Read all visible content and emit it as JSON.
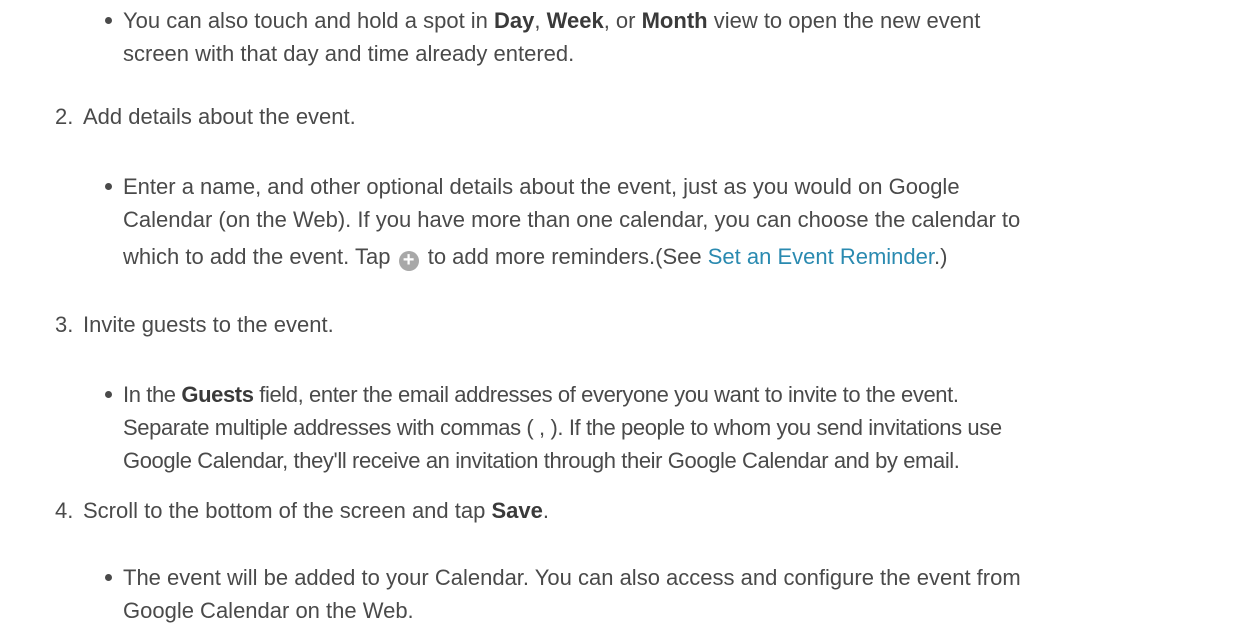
{
  "steps": [
    {
      "number": "",
      "bullets": [
        {
          "lines": [
            {
              "parts": [
                "You can also touch and hold a spot in ",
                "Day",
                ", ",
                "Week",
                ", or ",
                "Month",
                " view to open the new event"
              ]
            },
            {
              "parts": [
                "screen with that day and time already entered."
              ]
            }
          ]
        }
      ]
    },
    {
      "number": "2.",
      "title": "Add details about the event.",
      "bullet_lines": [
        "Enter a name, and other optional details about the event, just as you would on Google",
        "Calendar (on the Web). If you have more than one calendar, you can choose the calendar to"
      ],
      "bullet_line3_before": "which to add the event. Tap",
      "bullet_line3_after": "to add more reminders.(See ",
      "link_text": "Set an Event Reminder",
      "bullet_line3_end": ".)",
      "icon": "plus-circle-icon"
    },
    {
      "number": "3.",
      "title": "Invite guests to the event.",
      "bullet_line1_before": "In the ",
      "bullet_line1_bold": "Guests",
      "bullet_line1_after": " field, enter the email addresses of everyone you want to invite to the event.",
      "bullet_line2": "Separate multiple addresses with commas ( , ). If the people to whom you send invitations use",
      "bullet_line3": "Google Calendar, they'll receive an invitation through their Google Calendar and by email."
    },
    {
      "number": "4.",
      "title_before": "Scroll to the bottom of the screen and tap ",
      "title_bold": "Save",
      "title_after": ".",
      "bullet_line1": "The event will be added to your Calendar. You can also access and configure the event from",
      "bullet_line2": "Google Calendar on the Web."
    }
  ],
  "colors": {
    "text": "#4a4a4a",
    "link": "#2a8ab0",
    "icon": "#a8a8a8"
  }
}
